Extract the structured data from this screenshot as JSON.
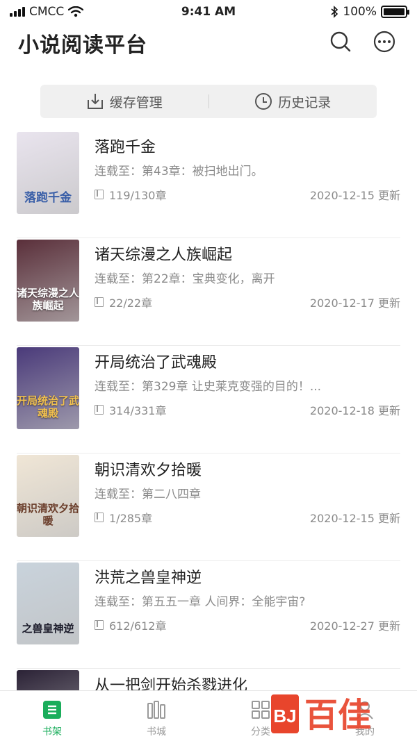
{
  "status_bar": {
    "carrier": "CMCC",
    "time": "9:41 AM",
    "battery": "100%",
    "battery_level": 1.0
  },
  "header": {
    "title": "小说阅读平台",
    "search_icon": "search-icon",
    "more_icon": "more-icon"
  },
  "toolbar": {
    "cache_label": "缓存管理",
    "history_label": "历史记录"
  },
  "colors": {
    "accent": "#1aad5b",
    "watermark": "#e8452c"
  },
  "books": [
    {
      "title": "落跑千金",
      "latest": "连载至：第43章：被扫地出门。",
      "progress": "119/130章",
      "date": "2020-12-15 更新",
      "cover_text": "落跑千金",
      "cover_bg": "#e9e4ee"
    },
    {
      "title": "诸天综漫之人族崛起",
      "latest": "连载至：第22章：宝典变化，离开",
      "progress": "22/22章",
      "date": "2020-12-17 更新",
      "cover_text": "诸天综漫之人族崛起",
      "cover_bg": "#5a2f3a"
    },
    {
      "title": "开局统治了武魂殿",
      "latest": "连载至：第329章 让史莱克变强的目的！...",
      "progress": "314/331章",
      "date": "2020-12-18 更新",
      "cover_text": "开局统治了武魂殿",
      "cover_bg": "#4a3a7a"
    },
    {
      "title": "朝识清欢夕拾暖",
      "latest": "连载至：第二八四章",
      "progress": "1/285章",
      "date": "2020-12-15 更新",
      "cover_text": "朝识清欢夕拾暖",
      "cover_bg": "#f0e6d6"
    },
    {
      "title": "洪荒之兽皇神逆",
      "latest": "连载至：第五五一章 人间界：全能宇宙?",
      "progress": "612/612章",
      "date": "2020-12-27 更新",
      "cover_text": "之兽皇神逆",
      "cover_bg": "#c9d3dc"
    },
    {
      "title": "从一把剑开始杀戮进化",
      "latest": "",
      "progress": "",
      "date": "",
      "cover_text": "",
      "cover_bg": "#2b2236"
    }
  ],
  "tabs": [
    {
      "label": "书架",
      "icon": "bookshelf-icon",
      "active": true
    },
    {
      "label": "书城",
      "icon": "bookstore-icon",
      "active": false
    },
    {
      "label": "分类",
      "icon": "category-icon",
      "active": false
    },
    {
      "label": "我的",
      "icon": "profile-icon",
      "active": false
    }
  ],
  "watermark": {
    "text": "百佳",
    "logo_letters": "BJ"
  }
}
